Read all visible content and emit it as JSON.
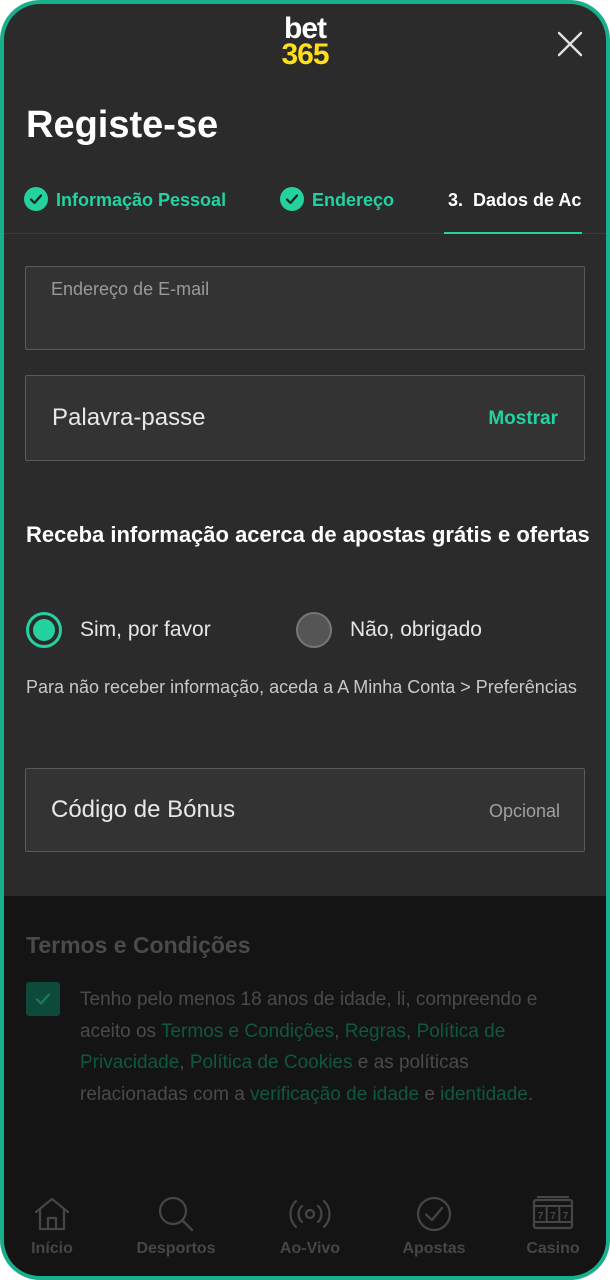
{
  "header": {
    "logo_line1": "bet",
    "logo_line2": "365",
    "title": "Registe-se"
  },
  "tabs": [
    {
      "label": "Informação Pessoal",
      "state": "done"
    },
    {
      "label": "Endereço",
      "state": "done"
    },
    {
      "label": "3.  Dados de Ac",
      "state": "active"
    }
  ],
  "form": {
    "email_placeholder": "Endereço de E-mail",
    "password_placeholder": "Palavra-passe",
    "show_label": "Mostrar",
    "offers_title": "Receba informação acerca de apostas grátis e ofertas",
    "radio_yes": "Sim, por favor",
    "radio_no": "Não, obrigado",
    "radio_selected": "yes",
    "pref_note": "Para não receber informação, aceda a A Minha Conta > Preferências",
    "bonus_placeholder": "Código de Bónus",
    "bonus_optional": "Opcional"
  },
  "terms": {
    "title": "Termos e Condições",
    "checked": true,
    "t1": "Tenho pelo menos 18 anos de idade, li, compreendo e aceito os ",
    "l1": "Termos e Condições",
    "s1": ", ",
    "l2": "Regras",
    "s2": ", ",
    "l3": "Política de Privacidade",
    "s3": ", ",
    "l4": "Política de Cookies",
    "t2": " e as políticas relacionadas com a ",
    "l5": "verificação de idade",
    "t3": " e ",
    "l6": "identidade",
    "t4": "."
  },
  "nav": [
    {
      "label": "Início",
      "icon": "home-icon"
    },
    {
      "label": "Desportos",
      "icon": "search-icon"
    },
    {
      "label": "Ao-Vivo",
      "icon": "live-icon"
    },
    {
      "label": "Apostas",
      "icon": "check-circle-icon"
    },
    {
      "label": "Casino",
      "icon": "slot-machine-icon"
    }
  ],
  "colors": {
    "accent": "#24d29f",
    "background": "#2b2b2b",
    "logo_yellow": "#ffdf1b"
  }
}
